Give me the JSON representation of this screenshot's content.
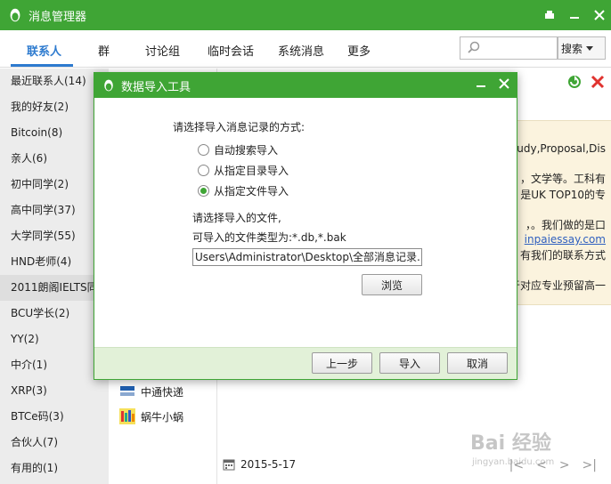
{
  "window": {
    "title": "消息管理器"
  },
  "nav": {
    "tabs": [
      "联系人",
      "群",
      "讨论组",
      "临时会话",
      "系统消息",
      "更多"
    ],
    "search_placeholder": "",
    "search_button": "搜索"
  },
  "sidebar": {
    "items": [
      "最近联系人(14)",
      "我的好友(2)",
      "Bitcoin(8)",
      "亲人(6)",
      "初中同学(2)",
      "高中同学(37)",
      "大学同学(55)",
      "HND老师(4)",
      "2011朗阁IELTS同...",
      "BCU学长(2)",
      "YY(2)",
      "中介(1)",
      "XRP(3)",
      "BTCe码(3)",
      "合伙人(7)",
      "有用的(1)"
    ]
  },
  "contacts": [
    "中通快递",
    "蜗牛小蜗"
  ],
  "message_panel": {
    "lines": [
      "tudy,Proposal,Dis",
      "，文学等。工科有",
      "是UK TOP10的专",
      "，。我们做的是口",
      "inpaiessay.com",
      "有我们的联系方式",
      "于对应专业预留高一"
    ]
  },
  "date": "2015-5-17",
  "dialog": {
    "title": "数据导入工具",
    "prompt": "请选择导入消息记录的方式:",
    "options": [
      "自动搜索导入",
      "从指定目录导入",
      "从指定文件导入"
    ],
    "selected_option": 2,
    "file_prompt": "请选择导入的文件,",
    "types_note": "可导入的文件类型为:*.db,*.bak",
    "path_value": "Users\\Administrator\\Desktop\\全部消息记录.bak",
    "browse": "浏览",
    "back": "上一步",
    "import": "导入",
    "cancel": "取消"
  },
  "watermark": {
    "text": "Bai 经验",
    "url": "jingyan.baidu.com"
  },
  "colors": {
    "brand_green": "#3fa535",
    "accent_blue": "#2e7bcf",
    "panel_bg": "#fbf3de",
    "footer_green": "#e2f1d8"
  }
}
